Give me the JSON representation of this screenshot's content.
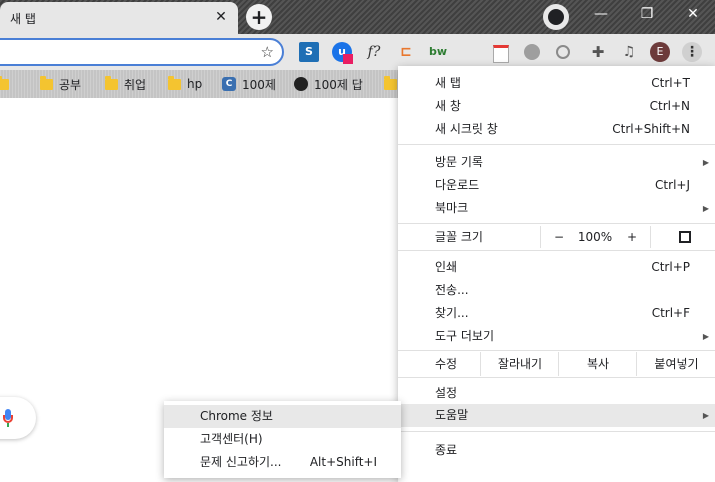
{
  "tab": {
    "title": "새 탭",
    "close": "✕"
  },
  "newtab": "+",
  "window": {
    "minimize": "—",
    "restore": "❐",
    "close": "✕"
  },
  "toolbar": {
    "star": "☆",
    "extensions": [
      "S",
      "u",
      "f?",
      "⊏",
      "bw",
      "",
      "",
      "",
      "",
      "",
      "E",
      "⋮"
    ]
  },
  "bookmarks": [
    {
      "label": "",
      "icon": "folder"
    },
    {
      "label": "공부",
      "icon": "folder"
    },
    {
      "label": "취업",
      "icon": "folder"
    },
    {
      "label": "hp",
      "icon": "folder"
    },
    {
      "label": "100제",
      "icon": "c-badge"
    },
    {
      "label": "100제 답",
      "icon": "github"
    },
    {
      "label": "",
      "icon": "folder"
    }
  ],
  "menu": {
    "new_tab": {
      "label": "새 탭",
      "shortcut": "Ctrl+T"
    },
    "new_window": {
      "label": "새 창",
      "shortcut": "Ctrl+N"
    },
    "incognito": {
      "label": "새 시크릿 창",
      "shortcut": "Ctrl+Shift+N"
    },
    "history": {
      "label": "방문 기록",
      "arrow": "▶"
    },
    "downloads": {
      "label": "다운로드",
      "shortcut": "Ctrl+J"
    },
    "bookmarks": {
      "label": "북마크",
      "arrow": "▶"
    },
    "zoom": {
      "label": "글꼴 크기",
      "minus": "−",
      "value": "100%",
      "plus": "+"
    },
    "print": {
      "label": "인쇄",
      "shortcut": "Ctrl+P"
    },
    "cast": {
      "label": "전송..."
    },
    "find": {
      "label": "찾기...",
      "shortcut": "Ctrl+F"
    },
    "more_tools": {
      "label": "도구 더보기",
      "arrow": "▶"
    },
    "edit": {
      "label": "수정",
      "cut": "잘라내기",
      "copy": "복사",
      "paste": "붙여넣기"
    },
    "settings": {
      "label": "설정"
    },
    "help": {
      "label": "도움말",
      "arrow": "▶"
    },
    "exit": {
      "label": "종료"
    }
  },
  "submenu": {
    "about": {
      "label": "Chrome 정보"
    },
    "help_center": {
      "label": "고객센터(H)"
    },
    "report": {
      "label": "문제 신고하기...",
      "shortcut": "Alt+Shift+I"
    }
  }
}
